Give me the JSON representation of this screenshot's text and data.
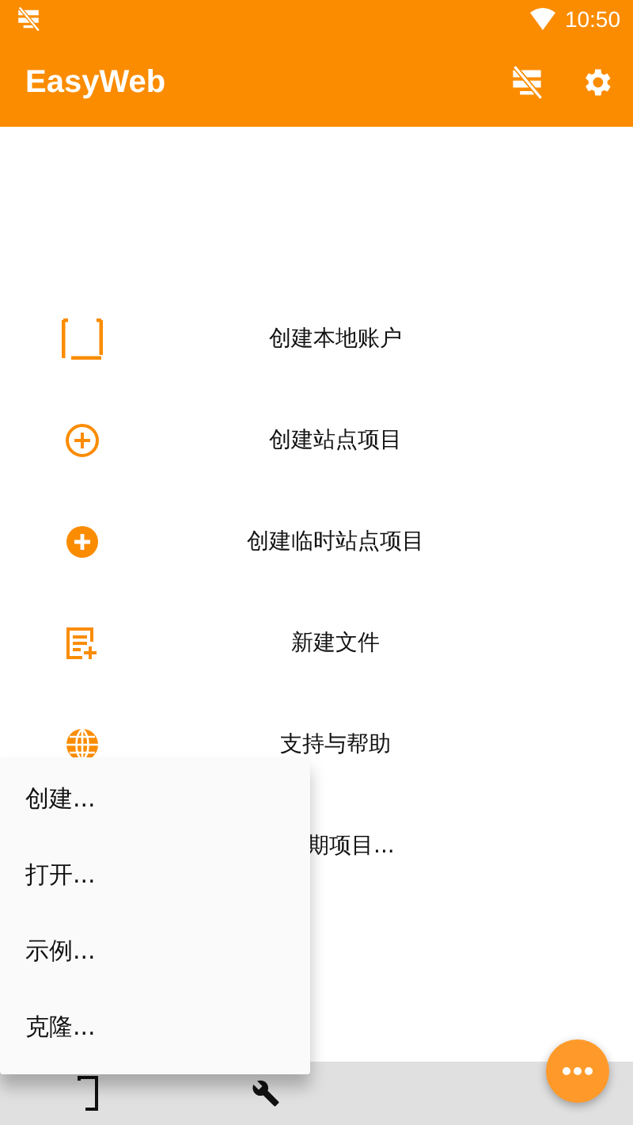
{
  "status_bar": {
    "time": "10:50"
  },
  "app_bar": {
    "title": "EasyWeb"
  },
  "actions": [
    {
      "kind": "square",
      "label": "创建本地账户"
    },
    {
      "kind": "plus-outline",
      "label": "创建站点项目"
    },
    {
      "kind": "plus-filled",
      "label": "创建临时站点项目"
    },
    {
      "kind": "file",
      "label": "新建文件"
    },
    {
      "kind": "globe",
      "label": "支持与帮助"
    },
    {
      "kind": "partial",
      "label": "期项目..."
    }
  ],
  "popup_menu": [
    "创建...",
    "打开...",
    "示例...",
    "克隆..."
  ]
}
